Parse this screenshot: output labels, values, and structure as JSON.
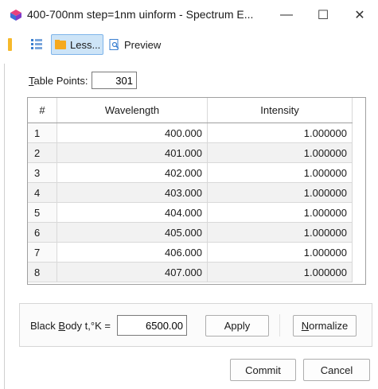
{
  "window": {
    "title": "400-700nm step=1nm uinform - Spectrum E...",
    "app_icon": "spectrum-app-icon",
    "minimize_glyph": "—",
    "maximize_glyph": "☐",
    "close_glyph": "✕"
  },
  "toolbar": {
    "less_label": "Less...",
    "preview_label": "Preview"
  },
  "table_points": {
    "label_prefix": "",
    "label_mnemonic": "T",
    "label_rest": "able Points:",
    "value": "301"
  },
  "grid": {
    "columns": [
      "#",
      "Wavelength",
      "Intensity"
    ],
    "rows": [
      {
        "n": "1",
        "wavelength": "400.000",
        "intensity": "1.000000"
      },
      {
        "n": "2",
        "wavelength": "401.000",
        "intensity": "1.000000"
      },
      {
        "n": "3",
        "wavelength": "402.000",
        "intensity": "1.000000"
      },
      {
        "n": "4",
        "wavelength": "403.000",
        "intensity": "1.000000"
      },
      {
        "n": "5",
        "wavelength": "404.000",
        "intensity": "1.000000"
      },
      {
        "n": "6",
        "wavelength": "405.000",
        "intensity": "1.000000"
      },
      {
        "n": "7",
        "wavelength": "406.000",
        "intensity": "1.000000"
      },
      {
        "n": "8",
        "wavelength": "407.000",
        "intensity": "1.000000"
      }
    ],
    "scroll_up_glyph": "▲",
    "scroll_down_glyph": "▼"
  },
  "black_body": {
    "label_prefix": "Black ",
    "label_mnemonic": "B",
    "label_rest": "ody t,°K =",
    "value": "6500.00",
    "apply_label": "Apply",
    "normalize_mnemonic": "N",
    "normalize_rest": "ormalize"
  },
  "footer": {
    "commit_label": "Commit",
    "cancel_label": "Cancel"
  },
  "colors": {
    "accent_selected": "#cde4f7",
    "toolbar_orange": "#f6b92b",
    "grid_alt_row": "#f2f2f2"
  }
}
